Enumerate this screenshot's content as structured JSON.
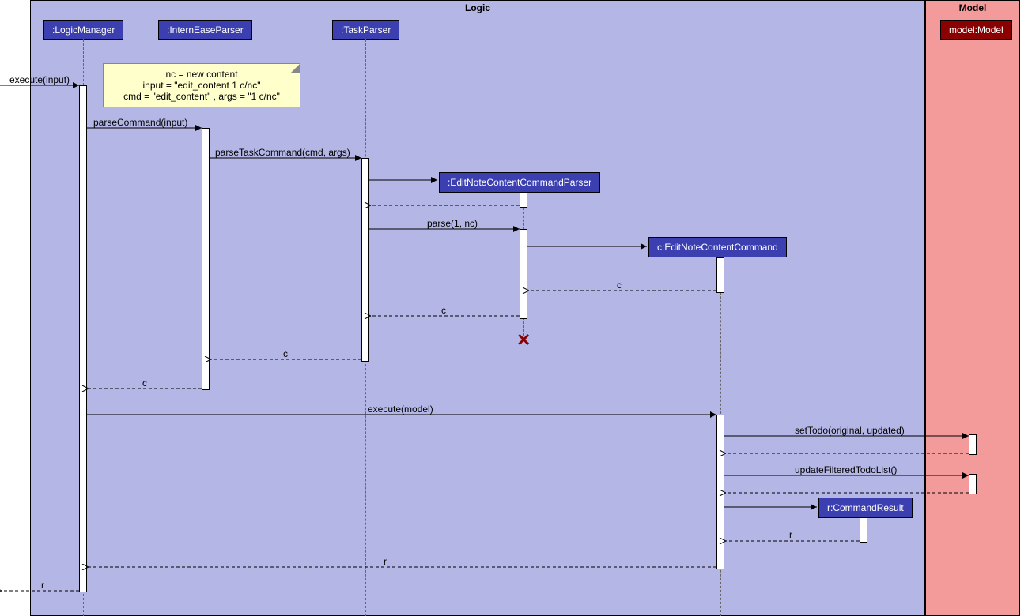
{
  "frames": {
    "logic": "Logic",
    "model": "Model"
  },
  "participants": {
    "logicManager": ":LogicManager",
    "internEaseParser": ":InternEaseParser",
    "taskParser": ":TaskParser",
    "editNoteParser": ":EditNoteContentCommandParser",
    "editNoteCmd": "c:EditNoteContentCommand",
    "commandResult": "r:CommandResult",
    "model": "model:Model"
  },
  "note": {
    "line1": "nc = new content",
    "line2": "input = \"edit_content 1 c/nc\"",
    "line3": "cmd = \"edit_content\" , args = \"1 c/nc\""
  },
  "messages": {
    "executeInput": "execute(input)",
    "parseCommand": "parseCommand(input)",
    "parseTaskCommand": "parseTaskCommand(cmd, args)",
    "parse": "parse(1, nc)",
    "c_ret1": "c",
    "c_ret2": "c",
    "c_ret3": "c",
    "c_ret4": "c",
    "executeModel": "execute(model)",
    "setTodo": "setTodo(original, updated)",
    "updateFiltered": "updateFilteredTodoList()",
    "r_ret1": "r",
    "r_ret2": "r",
    "r_ret3": "r"
  }
}
